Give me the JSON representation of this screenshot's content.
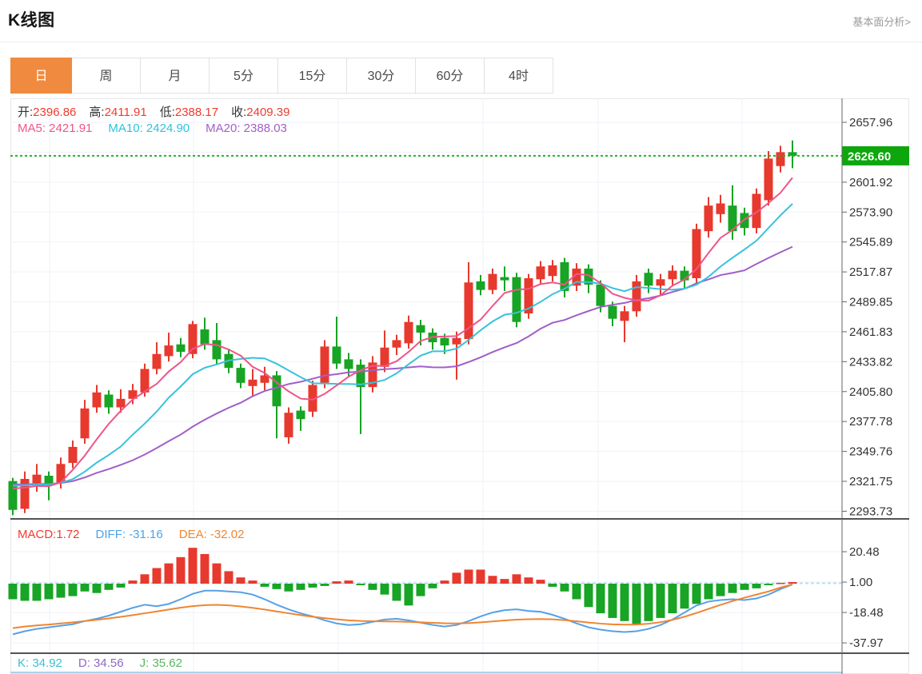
{
  "header": {
    "title": "K线图",
    "link": "基本面分析>"
  },
  "tabs": {
    "items": [
      "日",
      "周",
      "月",
      "5分",
      "15分",
      "30分",
      "60分",
      "4时"
    ],
    "active": "日"
  },
  "indicators": {
    "ohlc": [
      {
        "label": "开:",
        "value": "2396.86"
      },
      {
        "label": "高:",
        "value": "2411.91"
      },
      {
        "label": "低:",
        "value": "2388.17"
      },
      {
        "label": "收:",
        "value": "2409.39"
      }
    ],
    "ma": [
      {
        "text": "MA5: 2421.91",
        "color": "#ee5588"
      },
      {
        "text": "MA10: 2424.90",
        "color": "#2cc3dc"
      },
      {
        "text": "MA20: 2388.03",
        "color": "#a25fc8"
      }
    ],
    "macd": [
      {
        "text": "MACD:1.72",
        "color": "#f03b30"
      },
      {
        "text": "DIFF: -31.16",
        "color": "#4da3e8"
      },
      {
        "text": "DEA: -32.02",
        "color": "#ef8632"
      }
    ],
    "kdj": [
      {
        "text": "K: 34.92",
        "color": "#3bbfd4"
      },
      {
        "text": "D: 34.56",
        "color": "#9168c5"
      },
      {
        "text": "J: 35.62",
        "color": "#55b85f"
      }
    ]
  },
  "chart_data": {
    "type": "candlestick",
    "legend": "red = up (红涨), green = down (绿跌)",
    "price_axis": {
      "ticks": [
        2657.96,
        2601.92,
        2573.9,
        2545.89,
        2517.87,
        2489.85,
        2461.83,
        2433.82,
        2405.8,
        2377.78,
        2349.76,
        2321.75,
        2293.73
      ],
      "hidden_tick": 2629.94,
      "current_price": 2626.6
    },
    "ohlc_format": "open,close,low,high",
    "candles": [
      [
        2322,
        2295,
        2290,
        2325
      ],
      [
        2296,
        2324,
        2292,
        2331
      ],
      [
        2320,
        2328,
        2312,
        2338
      ],
      [
        2327,
        2319,
        2304,
        2331
      ],
      [
        2320,
        2338,
        2315,
        2344
      ],
      [
        2339,
        2354,
        2334,
        2360
      ],
      [
        2362,
        2390,
        2357,
        2398
      ],
      [
        2391,
        2405,
        2386,
        2412
      ],
      [
        2403,
        2391,
        2385,
        2407
      ],
      [
        2391,
        2399,
        2386,
        2408
      ],
      [
        2399,
        2407,
        2394,
        2413
      ],
      [
        2405,
        2427,
        2401,
        2432
      ],
      [
        2427,
        2441,
        2422,
        2452
      ],
      [
        2439,
        2449,
        2434,
        2461
      ],
      [
        2450,
        2443,
        2438,
        2456
      ],
      [
        2441,
        2469,
        2437,
        2472
      ],
      [
        2464,
        2450,
        2445,
        2475
      ],
      [
        2454,
        2436,
        2431,
        2470
      ],
      [
        2441,
        2428,
        2423,
        2446
      ],
      [
        2428,
        2414,
        2409,
        2432
      ],
      [
        2411,
        2417,
        2402,
        2427
      ],
      [
        2414,
        2421,
        2407,
        2429
      ],
      [
        2421,
        2392,
        2362,
        2425
      ],
      [
        2363,
        2386,
        2357,
        2391
      ],
      [
        2388,
        2380,
        2369,
        2392
      ],
      [
        2387,
        2412,
        2382,
        2416
      ],
      [
        2414,
        2448,
        2409,
        2454
      ],
      [
        2448,
        2432,
        2427,
        2476
      ],
      [
        2436,
        2427,
        2420,
        2442
      ],
      [
        2431,
        2410,
        2366,
        2436
      ],
      [
        2410,
        2433,
        2405,
        2439
      ],
      [
        2429,
        2447,
        2424,
        2463
      ],
      [
        2447,
        2454,
        2440,
        2459
      ],
      [
        2451,
        2471,
        2446,
        2477
      ],
      [
        2468,
        2461,
        2449,
        2473
      ],
      [
        2461,
        2452,
        2445,
        2465
      ],
      [
        2456,
        2449,
        2441,
        2460
      ],
      [
        2450,
        2456,
        2417,
        2462
      ],
      [
        2455,
        2508,
        2450,
        2527
      ],
      [
        2509,
        2501,
        2496,
        2515
      ],
      [
        2501,
        2516,
        2497,
        2521
      ],
      [
        2513,
        2510,
        2500,
        2523
      ],
      [
        2513,
        2471,
        2466,
        2517
      ],
      [
        2479,
        2512,
        2474,
        2516
      ],
      [
        2511,
        2523,
        2506,
        2528
      ],
      [
        2514,
        2524,
        2509,
        2529
      ],
      [
        2527,
        2500,
        2494,
        2531
      ],
      [
        2505,
        2521,
        2500,
        2526
      ],
      [
        2521,
        2506,
        2498,
        2525
      ],
      [
        2506,
        2486,
        2480,
        2510
      ],
      [
        2486,
        2474,
        2467,
        2490
      ],
      [
        2472,
        2481,
        2452,
        2486
      ],
      [
        2481,
        2509,
        2476,
        2515
      ],
      [
        2517,
        2505,
        2498,
        2521
      ],
      [
        2505,
        2511,
        2496,
        2516
      ],
      [
        2511,
        2519,
        2505,
        2524
      ],
      [
        2519,
        2510,
        2503,
        2523
      ],
      [
        2512,
        2558,
        2507,
        2563
      ],
      [
        2556,
        2580,
        2550,
        2588
      ],
      [
        2572,
        2582,
        2564,
        2590
      ],
      [
        2580,
        2556,
        2548,
        2599
      ],
      [
        2573,
        2559,
        2552,
        2578
      ],
      [
        2559,
        2591,
        2554,
        2596
      ],
      [
        2585,
        2624,
        2580,
        2631
      ],
      [
        2617,
        2630,
        2611,
        2636
      ],
      [
        2630,
        2626.6,
        2615,
        2641
      ]
    ],
    "ma_periods": [
      5,
      10,
      20
    ],
    "macd": {
      "ticks": [
        20.48,
        1.0,
        -18.48,
        -37.97
      ],
      "histogram": [
        -10,
        -11,
        -11,
        -10,
        -9,
        -8,
        -5,
        -6,
        -4,
        -2.5,
        2,
        6,
        10,
        13,
        17,
        23,
        19,
        13,
        8,
        4,
        2,
        -2,
        -3.5,
        -5,
        -4,
        -2.5,
        -1.5,
        1.5,
        2,
        -1,
        -4,
        -7,
        -11,
        -14,
        -8,
        -3,
        2,
        7,
        9,
        9,
        5,
        3,
        6,
        4,
        2.5,
        -2,
        -5,
        -10,
        -15,
        -19,
        -22,
        -24,
        -26,
        -24,
        -22,
        -19,
        -16,
        -13,
        -10,
        -8,
        -6,
        -4,
        -3,
        -1,
        0.5,
        1
      ],
      "diff": [
        -32.5,
        -30.5,
        -29,
        -28,
        -27,
        -26,
        -24,
        -22.5,
        -20.5,
        -18,
        -15.5,
        -13.5,
        -14.5,
        -13,
        -10,
        -6.5,
        -4.5,
        -4.5,
        -5,
        -5.5,
        -7,
        -10,
        -13.5,
        -16.5,
        -19,
        -21,
        -23.5,
        -25.5,
        -26.5,
        -26,
        -24.5,
        -23,
        -22.5,
        -23.5,
        -25,
        -26.5,
        -27.5,
        -26.5,
        -24,
        -21,
        -18.5,
        -17,
        -16.5,
        -17.5,
        -18,
        -20,
        -22.5,
        -25.5,
        -28,
        -29.5,
        -30.5,
        -31,
        -30.5,
        -29,
        -26.5,
        -23,
        -18.5,
        -14,
        -11.5,
        -10.5,
        -10,
        -10.5,
        -9.5,
        -7,
        -3.5,
        -0.5
      ],
      "dea": [
        -28.5,
        -27.5,
        -26.8,
        -26.2,
        -25.5,
        -24.8,
        -24,
        -23.2,
        -22.3,
        -21.3,
        -20.2,
        -19,
        -17.8,
        -16.6,
        -15.4,
        -14.4,
        -13.8,
        -13.6,
        -13.9,
        -14.6,
        -15.5,
        -16.6,
        -17.8,
        -19,
        -20.2,
        -21.2,
        -22.1,
        -22.9,
        -23.5,
        -23.9,
        -24.1,
        -24.2,
        -24.3,
        -24.5,
        -24.8,
        -25.1,
        -25.4,
        -25.5,
        -25.3,
        -24.8,
        -24.2,
        -23.6,
        -23.1,
        -22.8,
        -22.7,
        -22.9,
        -23.4,
        -24.1,
        -24.9,
        -25.6,
        -26.1,
        -26.3,
        -26.2,
        -25.7,
        -24.7,
        -23.2,
        -21.2,
        -18.8,
        -16.2,
        -13.6,
        -11.2,
        -9,
        -7,
        -5,
        -2.5,
        -0.5
      ]
    },
    "colors": {
      "up": "#e7392e",
      "down": "#18a425",
      "ma5": "#ee5588",
      "ma10": "#38c2dc",
      "ma20": "#a05fc8",
      "diff_line": "#55a1e8",
      "dea_line": "#ef8632",
      "price_line": "#27b127",
      "price_label_bg": "#0da60d",
      "axis": "#666666",
      "grid": "#edf2f8",
      "zero_dash": "#b5e0f5"
    }
  }
}
